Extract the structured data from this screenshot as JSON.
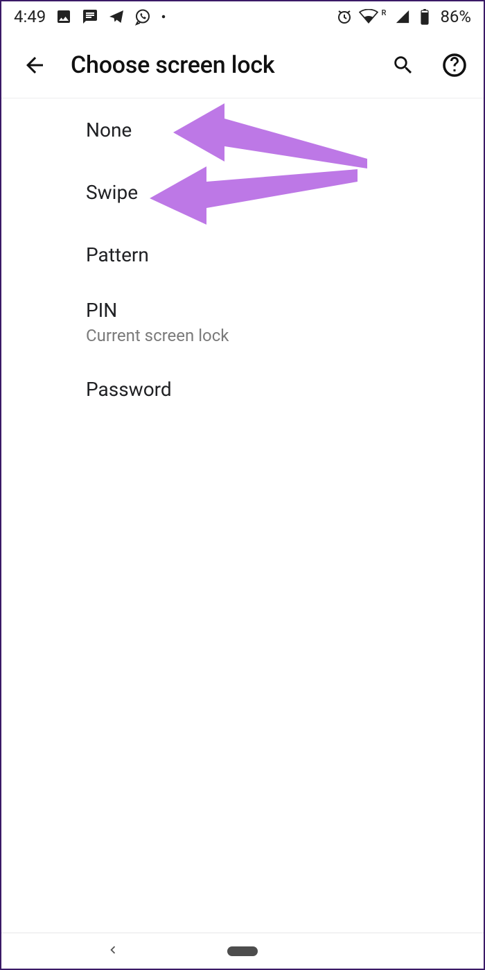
{
  "status": {
    "clock": "4:49",
    "battery_text": "86%",
    "roaming": "R"
  },
  "appbar": {
    "title": "Choose screen lock"
  },
  "options": {
    "none": {
      "label": "None"
    },
    "swipe": {
      "label": "Swipe"
    },
    "pattern": {
      "label": "Pattern"
    },
    "pin": {
      "label": "PIN",
      "sub": "Current screen lock"
    },
    "password": {
      "label": "Password"
    }
  },
  "colors": {
    "arrow": "#bd78e6"
  }
}
